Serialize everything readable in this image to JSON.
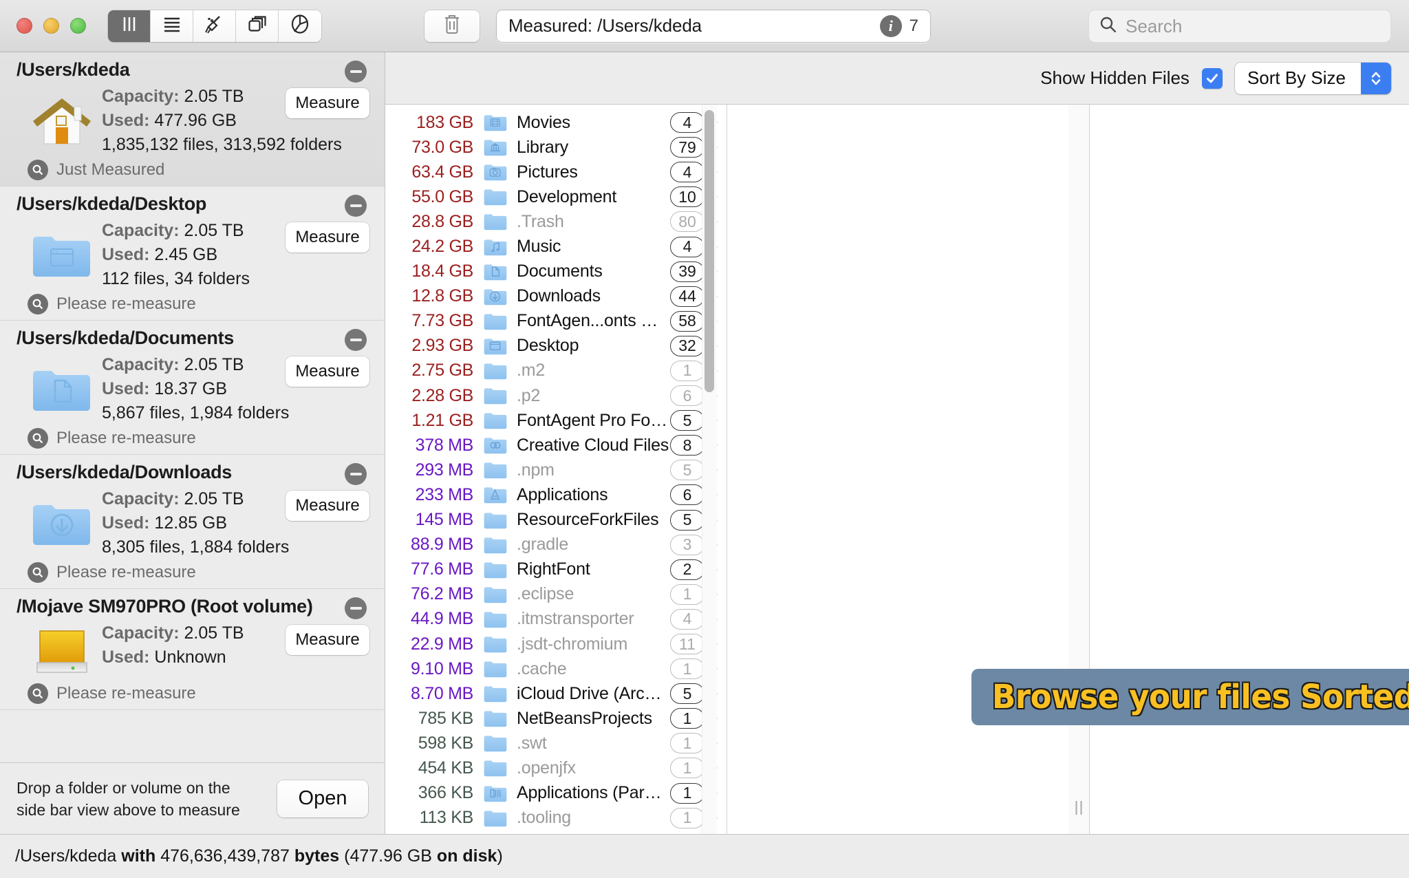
{
  "window": {
    "toolbar": {
      "view_modes": [
        {
          "name": "columns-view",
          "icon": "columns-icon",
          "active": true
        },
        {
          "name": "list-view",
          "icon": "list-icon",
          "active": false
        },
        {
          "name": "cleanup-view",
          "icon": "broom-icon",
          "active": false
        },
        {
          "name": "blocks-view",
          "icon": "blocks-icon",
          "active": false
        },
        {
          "name": "piechart-view",
          "icon": "pie-chart-icon",
          "active": false
        }
      ],
      "trash_button": "trash-icon",
      "path_field": {
        "value": "Measured: /Users/kdeda",
        "info_badge": "i",
        "info_count": "7"
      },
      "search": {
        "placeholder": "Search",
        "value": ""
      }
    }
  },
  "sidebar": {
    "items": [
      {
        "path": "/Users/kdeda",
        "icon": "home-folder-icon",
        "capacity_label": "Capacity:",
        "capacity_value": "2.05 TB",
        "used_label": "Used:",
        "used_value": "477.96 GB",
        "counts": "1,835,132 files, 313,592 folders",
        "status": "Just Measured",
        "measure_label": "Measure",
        "selected": true
      },
      {
        "path": "/Users/kdeda/Desktop",
        "icon": "desktop-folder-icon",
        "capacity_label": "Capacity:",
        "capacity_value": "2.05 TB",
        "used_label": "Used:",
        "used_value": "2.45 GB",
        "counts": "112 files, 34 folders",
        "status": "Please re-measure",
        "measure_label": "Measure",
        "selected": false
      },
      {
        "path": "/Users/kdeda/Documents",
        "icon": "documents-folder-icon",
        "capacity_label": "Capacity:",
        "capacity_value": "2.05 TB",
        "used_label": "Used:",
        "used_value": "18.37 GB",
        "counts": "5,867 files, 1,984 folders",
        "status": "Please re-measure",
        "measure_label": "Measure",
        "selected": false
      },
      {
        "path": "/Users/kdeda/Downloads",
        "icon": "downloads-folder-icon",
        "capacity_label": "Capacity:",
        "capacity_value": "2.05 TB",
        "used_label": "Used:",
        "used_value": "12.85 GB",
        "counts": "8,305 files, 1,884 folders",
        "status": "Please re-measure",
        "measure_label": "Measure",
        "selected": false
      },
      {
        "path": "/Mojave SM970PRO (Root volume)",
        "icon": "hard-drive-icon",
        "capacity_label": "Capacity:",
        "capacity_value": "2.05 TB",
        "used_label": "Used:",
        "used_value": "Unknown",
        "counts": "",
        "status": "Please re-measure",
        "measure_label": "Measure",
        "selected": false
      }
    ],
    "footer": {
      "drop_message": "Drop a folder or volume on the side bar view above to measure",
      "open_label": "Open"
    }
  },
  "browser": {
    "show_hidden_label": "Show Hidden Files",
    "show_hidden_checked": true,
    "sort_value": "Sort By Size",
    "rows": [
      {
        "size": "183 GB",
        "unit": "gb",
        "name": "Movies",
        "icon": "movies-folder-icon",
        "count": "4",
        "hidden": false
      },
      {
        "size": "73.0 GB",
        "unit": "gb",
        "name": "Library",
        "icon": "library-folder-icon",
        "count": "79",
        "hidden": false
      },
      {
        "size": "63.4 GB",
        "unit": "gb",
        "name": "Pictures",
        "icon": "pictures-folder-icon",
        "count": "4",
        "hidden": false
      },
      {
        "size": "55.0 GB",
        "unit": "gb",
        "name": "Development",
        "icon": "plain-folder-icon",
        "count": "10",
        "hidden": false
      },
      {
        "size": "28.8 GB",
        "unit": "gb",
        "name": ".Trash",
        "icon": "plain-folder-icon",
        "count": "80",
        "hidden": true
      },
      {
        "size": "24.2 GB",
        "unit": "gb",
        "name": "Music",
        "icon": "music-folder-icon",
        "count": "4",
        "hidden": false
      },
      {
        "size": "18.4 GB",
        "unit": "gb",
        "name": "Documents",
        "icon": "documents-folder-icon",
        "count": "39",
        "hidden": false
      },
      {
        "size": "12.8 GB",
        "unit": "gb",
        "name": "Downloads",
        "icon": "downloads-folder-icon",
        "count": "44",
        "hidden": false
      },
      {
        "size": "7.73 GB",
        "unit": "gb",
        "name": "FontAgen...onts MINE",
        "icon": "plain-folder-icon",
        "count": "58",
        "hidden": false
      },
      {
        "size": "2.93 GB",
        "unit": "gb",
        "name": "Desktop",
        "icon": "desktop-folder-icon",
        "count": "32",
        "hidden": false
      },
      {
        "size": "2.75 GB",
        "unit": "gb",
        "name": ".m2",
        "icon": "plain-folder-icon",
        "count": "1",
        "hidden": true
      },
      {
        "size": "2.28 GB",
        "unit": "gb",
        "name": ".p2",
        "icon": "plain-folder-icon",
        "count": "6",
        "hidden": true
      },
      {
        "size": "1.21 GB",
        "unit": "gb",
        "name": "FontAgent Pro Fonts",
        "icon": "plain-folder-icon",
        "count": "5",
        "hidden": false
      },
      {
        "size": "378 MB",
        "unit": "mb",
        "name": "Creative Cloud Files",
        "icon": "creative-cloud-folder-icon",
        "count": "8",
        "hidden": false
      },
      {
        "size": "293 MB",
        "unit": "mb",
        "name": ".npm",
        "icon": "plain-folder-icon",
        "count": "5",
        "hidden": true
      },
      {
        "size": "233 MB",
        "unit": "mb",
        "name": "Applications",
        "icon": "applications-folder-icon",
        "count": "6",
        "hidden": false
      },
      {
        "size": "145 MB",
        "unit": "mb",
        "name": "ResourceForkFiles",
        "icon": "plain-folder-icon",
        "count": "5",
        "hidden": false
      },
      {
        "size": "88.9 MB",
        "unit": "mb",
        "name": ".gradle",
        "icon": "plain-folder-icon",
        "count": "3",
        "hidden": true
      },
      {
        "size": "77.6 MB",
        "unit": "mb",
        "name": "RightFont",
        "icon": "plain-folder-icon",
        "count": "2",
        "hidden": false
      },
      {
        "size": "76.2 MB",
        "unit": "mb",
        "name": ".eclipse",
        "icon": "plain-folder-icon",
        "count": "1",
        "hidden": true
      },
      {
        "size": "44.9 MB",
        "unit": "mb",
        "name": ".itmstransporter",
        "icon": "plain-folder-icon",
        "count": "4",
        "hidden": true
      },
      {
        "size": "22.9 MB",
        "unit": "mb",
        "name": ".jsdt-chromium",
        "icon": "plain-folder-icon",
        "count": "11",
        "hidden": true
      },
      {
        "size": "9.10 MB",
        "unit": "mb",
        "name": ".cache",
        "icon": "plain-folder-icon",
        "count": "1",
        "hidden": true
      },
      {
        "size": "8.70 MB",
        "unit": "mb",
        "name": "iCloud Drive (Archive)",
        "icon": "plain-folder-icon",
        "count": "5",
        "hidden": false
      },
      {
        "size": "785 KB",
        "unit": "kb",
        "name": "NetBeansProjects",
        "icon": "plain-folder-icon",
        "count": "1",
        "hidden": false
      },
      {
        "size": "598 KB",
        "unit": "kb",
        "name": ".swt",
        "icon": "plain-folder-icon",
        "count": "1",
        "hidden": true
      },
      {
        "size": "454 KB",
        "unit": "kb",
        "name": ".openjfx",
        "icon": "plain-folder-icon",
        "count": "1",
        "hidden": true
      },
      {
        "size": "366 KB",
        "unit": "kb",
        "name": "Applications (Parallels)",
        "icon": "parallels-folder-icon",
        "count": "1",
        "hidden": false
      },
      {
        "size": "113 KB",
        "unit": "kb",
        "name": ".tooling",
        "icon": "plain-folder-icon",
        "count": "1",
        "hidden": true
      }
    ]
  },
  "banner": {
    "text": "Browse your files Sorted By Size",
    "background": "#6c88a4",
    "text_color": "#f9c022"
  },
  "statusbar": {
    "path": "/Users/kdeda",
    "with_word": "with",
    "bytes": "476,636,439,787",
    "bytes_word": "bytes",
    "paren_open": "(",
    "on_disk_size": "477.96 GB",
    "on_disk_word": "on disk",
    "paren_close": ")"
  }
}
